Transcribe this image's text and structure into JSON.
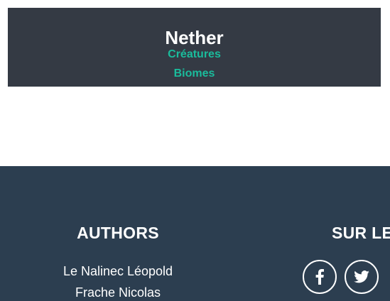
{
  "nav": {
    "title": "Nether",
    "links": [
      {
        "label": "Créatures"
      },
      {
        "label": "Biomes"
      }
    ]
  },
  "footer": {
    "authors": {
      "heading": "AUTHORS",
      "names": [
        "Le Nalinec Léopold",
        "Frache Nicolas"
      ]
    },
    "social": {
      "heading": "SUR LE",
      "icons": [
        "facebook-icon",
        "twitter-icon"
      ]
    }
  },
  "colors": {
    "nav_background": "#343a44",
    "link_accent": "#1abc9c",
    "footer_background": "#2c3e50",
    "text": "#ffffff"
  }
}
